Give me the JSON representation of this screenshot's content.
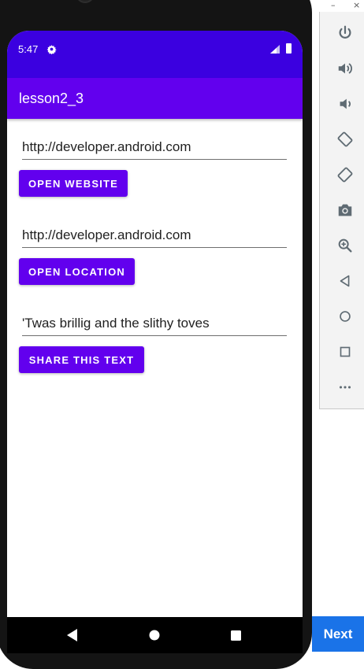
{
  "status_bar": {
    "time": "5:47"
  },
  "app_bar": {
    "title": "lesson2_3"
  },
  "form": {
    "website_field": {
      "value": "http://developer.android.com"
    },
    "website_button": {
      "label": "OPEN WEBSITE"
    },
    "location_field": {
      "value": "http://developer.android.com"
    },
    "location_button": {
      "label": "OPEN LOCATION"
    },
    "share_field": {
      "value": "'Twas brillig and the slithy toves"
    },
    "share_button": {
      "label": "SHARE THIS TEXT"
    }
  },
  "nav_bar": {
    "buttons": [
      "back-icon",
      "home-icon",
      "recents-icon"
    ]
  },
  "emulator_panel": {
    "window_controls": {
      "minimize": "–",
      "close": "×"
    },
    "tools": [
      "power-icon",
      "volume-up-icon",
      "volume-down-icon",
      "rotate-left-icon",
      "rotate-right-icon",
      "camera-icon",
      "zoom-icon",
      "back-icon",
      "home-icon",
      "overview-icon",
      "more-icon"
    ]
  },
  "wizard": {
    "next_label": "Next"
  },
  "colors": {
    "status_bar": "#3b00e0",
    "primary": "#6200ee",
    "next_button": "#1a73e8"
  }
}
